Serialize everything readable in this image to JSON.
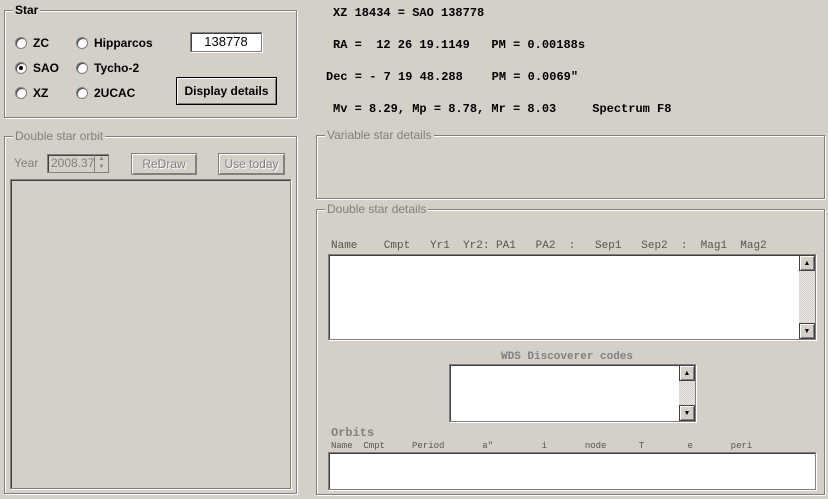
{
  "star_group": {
    "legend": "Star",
    "radios": [
      {
        "label": "ZC",
        "checked": false
      },
      {
        "label": "Hipparcos",
        "checked": false
      },
      {
        "label": "SAO",
        "checked": true
      },
      {
        "label": "Tycho-2",
        "checked": false
      },
      {
        "label": "XZ",
        "checked": false
      },
      {
        "label": "2UCAC",
        "checked": false
      }
    ],
    "star_number": "138778",
    "display_button": "Display details"
  },
  "info": {
    "line1": "XZ 18434 = SAO 138778",
    "line2": "RA =  12 26 19.1149   PM = 0.00188s",
    "line3": "Dec = - 7 19 48.288    PM = 0.0069\"",
    "line4": "Mv = 8.29, Mp = 8.78, Mr = 8.03     Spectrum F8"
  },
  "orbit_group": {
    "legend": "Double star orbit",
    "year_label": "Year",
    "year_value": "2008.37",
    "redraw_button": "ReDraw",
    "use_today_button": "Use today"
  },
  "variable_group": {
    "legend": "Variable star details"
  },
  "double_group": {
    "legend": "Double star details",
    "columns_header": "Name    Cmpt   Yr1  Yr2: PA1   PA2  :   Sep1   Sep2  :  Mag1  Mag2",
    "wds_label": "WDS Discoverer codes",
    "orbits_label": "Orbits",
    "orbits_header": "Name  Cmpt     Period       a\"         i       node      T        e       peri"
  }
}
